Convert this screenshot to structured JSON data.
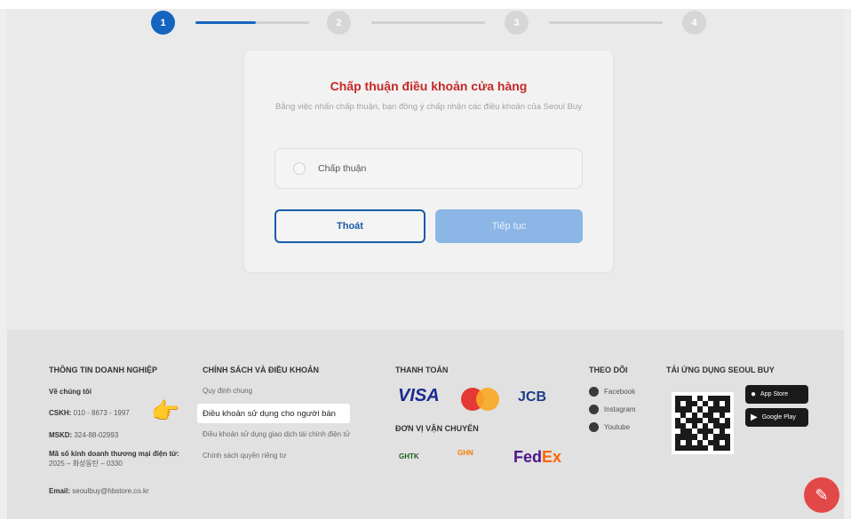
{
  "stepper": {
    "steps": [
      "1",
      "2",
      "3",
      "4"
    ],
    "active": 1
  },
  "card": {
    "title": "Chấp thuận điều khoản cửa hàng",
    "subtitle": "Bằng việc nhấn chấp thuận, bạn đồng ý chấp nhận các điều khoản của Seoul Buy",
    "consent_label": "Chấp thuận",
    "exit_label": "Thoát",
    "continue_label": "Tiếp tục"
  },
  "footer": {
    "business": {
      "heading": "THÔNG TIN DOANH NGHIỆP",
      "about": "Về chúng tôi",
      "cskh_label": "CSKH:",
      "cskh_value": "010 - 8673 - 1997",
      "mskd_label": "MSKD:",
      "mskd_value": "324-88-02993",
      "license_label": "Mã số kinh doanh thương mại điện tử:",
      "license_value": "2025 – 화성동탄 – 0330",
      "email_label": "Email:",
      "email_value": "seoulbuy@hbstore.co.kr"
    },
    "policy": {
      "heading": "CHÍNH SÁCH VÀ ĐIỀU KHOẢN",
      "links": [
        "Quy định chung",
        "Điều khoản sử dụng cho người bán",
        "Điều khoản sử dụng giao dịch tài chính điện tử",
        "Chính sách quyền riêng tư"
      ]
    },
    "payment": {
      "heading": "THANH TOÁN",
      "logos": [
        "VISA",
        "MasterCard",
        "JCB"
      ],
      "shipping_heading": "ĐƠN VỊ VẬN CHUYỂN",
      "shipping_logos": [
        "GHTK",
        "GHN",
        "FedEx"
      ]
    },
    "follow": {
      "heading": "THEO DÕI",
      "items": [
        "Facebook",
        "Instagram",
        "Youtube"
      ]
    },
    "app": {
      "heading": "TẢI ỨNG DỤNG SEOUL BUY",
      "app_store": "App Store",
      "google_play": "Google Play"
    }
  },
  "icons": {
    "pointer": "pointing-hand-icon",
    "chat": "chat-bubble-icon"
  },
  "colors": {
    "primary": "#1565c0",
    "title_red": "#c62828",
    "fab": "#e34848"
  }
}
